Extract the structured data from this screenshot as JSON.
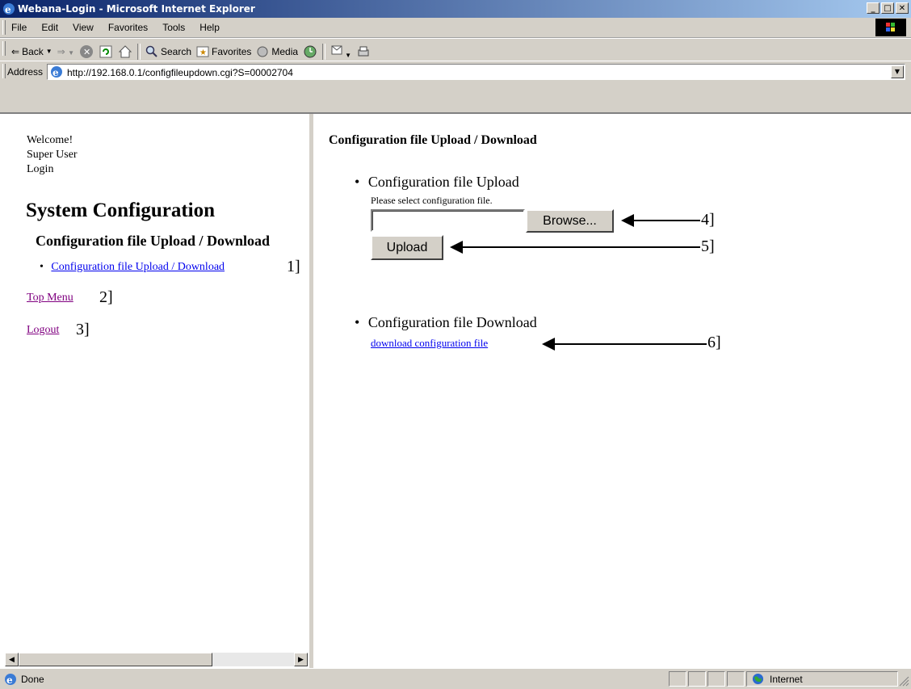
{
  "window": {
    "title": "Webana-Login - Microsoft Internet Explorer"
  },
  "menubar": {
    "items": [
      "File",
      "Edit",
      "View",
      "Favorites",
      "Tools",
      "Help"
    ]
  },
  "toolbar": {
    "back": "Back",
    "search": "Search",
    "favorites": "Favorites",
    "media": "Media"
  },
  "address": {
    "label": "Address",
    "url": "http://192.168.0.1/configfileupdown.cgi?S=00002704"
  },
  "left_frame": {
    "welcome": "Welcome!",
    "user": "Super User",
    "login": "Login",
    "heading": "System Configuration",
    "subheading": "Configuration file Upload / Download",
    "link_config": "Configuration file Upload / Download",
    "link_top_menu": "Top Menu",
    "link_logout": "Logout",
    "ann1": "1]",
    "ann2": "2]",
    "ann3": "3]"
  },
  "right_frame": {
    "title": "Configuration file Upload / Download",
    "upload_heading": "Configuration file Upload",
    "upload_hint": "Please select configuration file.",
    "file_input_value": "",
    "browse_label": "Browse...",
    "upload_label": "Upload",
    "download_heading": "Configuration file Download",
    "download_link": "download configuration file",
    "ann4": "4]",
    "ann5": "5]",
    "ann6": "6]"
  },
  "status": {
    "text": "Done",
    "zone": "Internet"
  }
}
